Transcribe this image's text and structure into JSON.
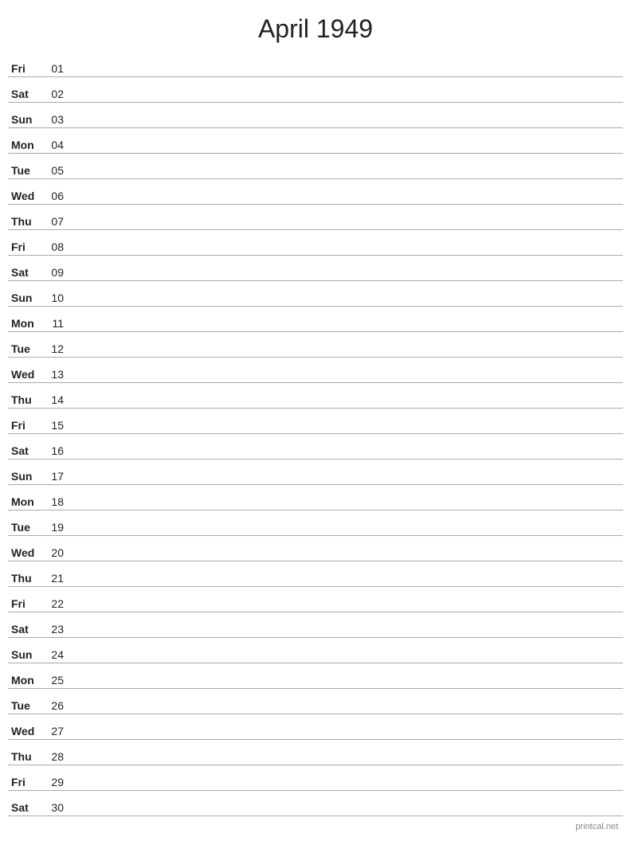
{
  "header": {
    "title": "April 1949"
  },
  "days": [
    {
      "name": "Fri",
      "number": "01"
    },
    {
      "name": "Sat",
      "number": "02"
    },
    {
      "name": "Sun",
      "number": "03"
    },
    {
      "name": "Mon",
      "number": "04"
    },
    {
      "name": "Tue",
      "number": "05"
    },
    {
      "name": "Wed",
      "number": "06"
    },
    {
      "name": "Thu",
      "number": "07"
    },
    {
      "name": "Fri",
      "number": "08"
    },
    {
      "name": "Sat",
      "number": "09"
    },
    {
      "name": "Sun",
      "number": "10"
    },
    {
      "name": "Mon",
      "number": "11"
    },
    {
      "name": "Tue",
      "number": "12"
    },
    {
      "name": "Wed",
      "number": "13"
    },
    {
      "name": "Thu",
      "number": "14"
    },
    {
      "name": "Fri",
      "number": "15"
    },
    {
      "name": "Sat",
      "number": "16"
    },
    {
      "name": "Sun",
      "number": "17"
    },
    {
      "name": "Mon",
      "number": "18"
    },
    {
      "name": "Tue",
      "number": "19"
    },
    {
      "name": "Wed",
      "number": "20"
    },
    {
      "name": "Thu",
      "number": "21"
    },
    {
      "name": "Fri",
      "number": "22"
    },
    {
      "name": "Sat",
      "number": "23"
    },
    {
      "name": "Sun",
      "number": "24"
    },
    {
      "name": "Mon",
      "number": "25"
    },
    {
      "name": "Tue",
      "number": "26"
    },
    {
      "name": "Wed",
      "number": "27"
    },
    {
      "name": "Thu",
      "number": "28"
    },
    {
      "name": "Fri",
      "number": "29"
    },
    {
      "name": "Sat",
      "number": "30"
    }
  ],
  "footer": {
    "text": "printcal.net"
  }
}
